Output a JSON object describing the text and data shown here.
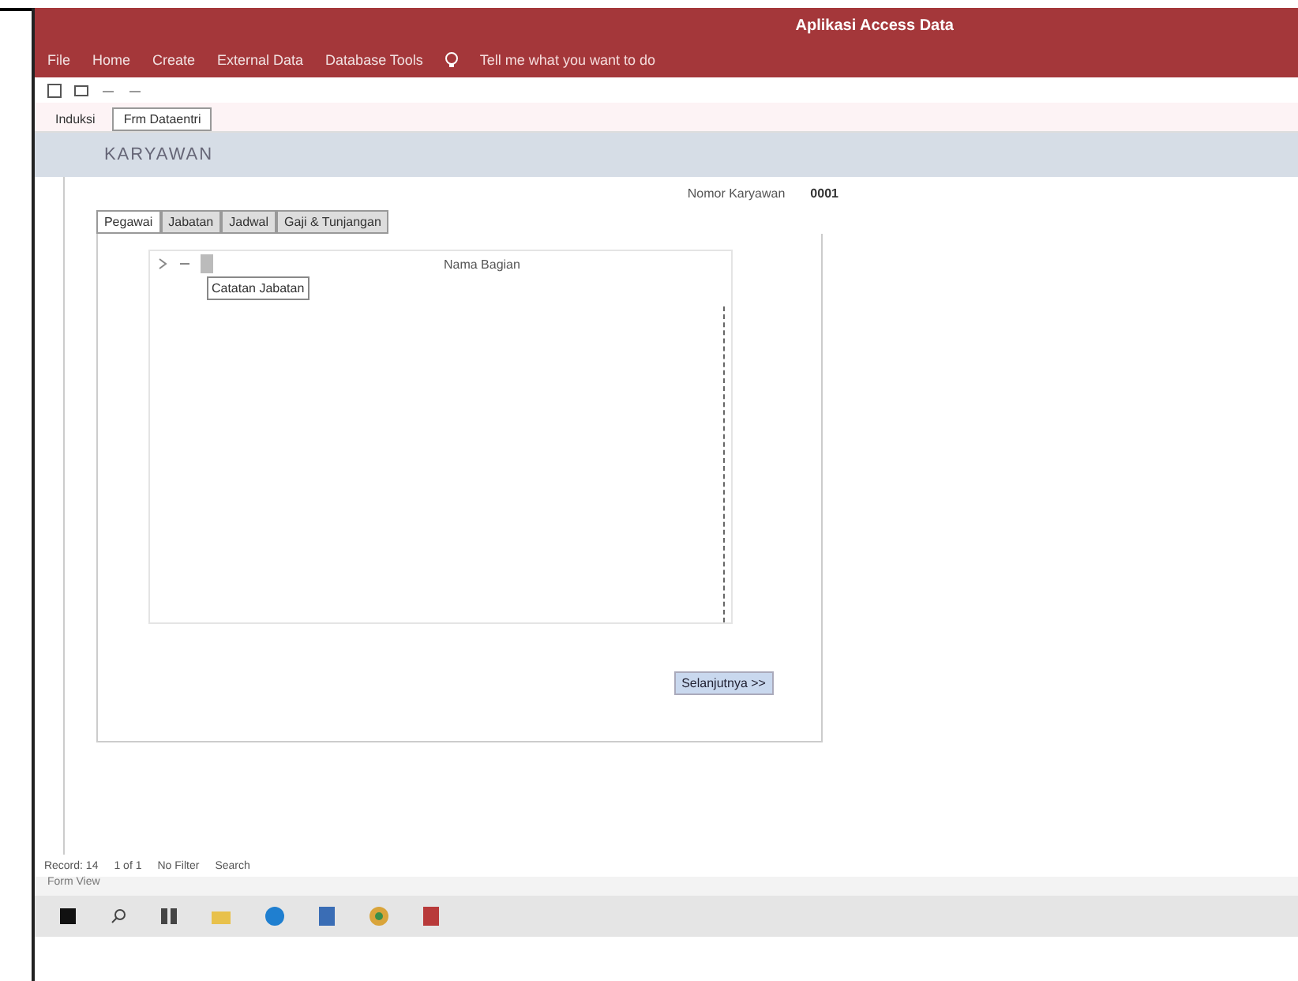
{
  "window": {
    "title": "Aplikasi Access Data"
  },
  "ribbon_tabs": [
    {
      "label": "File",
      "selected": false
    },
    {
      "label": "Home",
      "selected": false
    },
    {
      "label": "Create",
      "selected": false
    },
    {
      "label": "External Data",
      "selected": false
    },
    {
      "label": "Database Tools",
      "selected": false
    }
  ],
  "tell_me": "Tell me what you want to do",
  "document_tabs": [
    {
      "label": "Induksi",
      "selected": false
    },
    {
      "label": "Frm Dataentri",
      "selected": true
    }
  ],
  "form": {
    "header": "KARYAWAN",
    "id_label": "Nomor Karyawan",
    "id_value": "0001",
    "tabs": [
      {
        "label": "Pegawai",
        "selected": true
      },
      {
        "label": "Jabatan",
        "selected": false
      },
      {
        "label": "Jadwal",
        "selected": false
      },
      {
        "label": "Gaji & Tunjangan",
        "selected": false
      }
    ],
    "subform": {
      "label": "Nama Bagian",
      "cell": "Catatan Jabatan"
    },
    "next_button": "Selanjutnya >>"
  },
  "record_nav": {
    "label": "Record: 14",
    "position": "1 of 1",
    "filter": "No Filter",
    "search": "Search"
  },
  "status_bar": "Form View"
}
